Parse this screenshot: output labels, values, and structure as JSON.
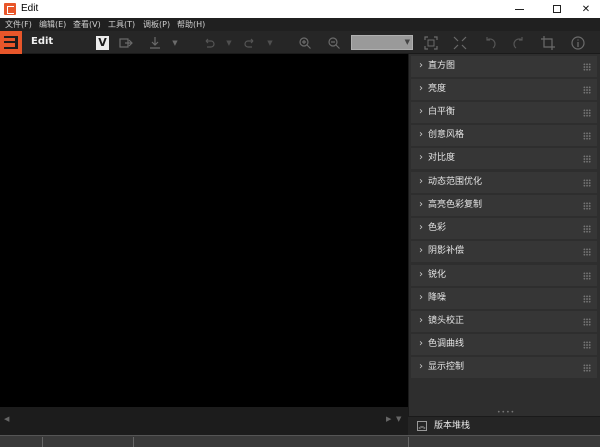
{
  "window": {
    "title": "Edit",
    "minimize_icon": "minimize-icon",
    "maximize_icon": "maximize-icon",
    "close_glyph": "✕"
  },
  "menu": [
    {
      "label": "文件(F)"
    },
    {
      "label": "编辑(E)"
    },
    {
      "label": "查看(V)"
    },
    {
      "label": "工具(T)"
    },
    {
      "label": "调板(P)"
    },
    {
      "label": "帮助(H)"
    }
  ],
  "toolbar": {
    "title": "Edit",
    "v_label": "V",
    "icons": [
      "export-icon",
      "download-icon",
      "undo-icon",
      "redo-icon",
      "zoom-in-icon",
      "zoom-out-icon",
      "fit-screen-icon",
      "actual-size-icon",
      "rotate-left-icon",
      "rotate-right-icon",
      "crop-icon",
      "info-icon"
    ]
  },
  "panel": {
    "items": [
      {
        "label": "直方图"
      },
      {
        "label": "亮度"
      },
      {
        "label": "白平衡"
      },
      {
        "label": "创意风格"
      },
      {
        "label": "对比度"
      },
      {
        "label": "动态范围优化"
      },
      {
        "label": "高亮色彩复制"
      },
      {
        "label": "色彩"
      },
      {
        "label": "阴影补偿"
      },
      {
        "label": "锐化"
      },
      {
        "label": "降噪"
      },
      {
        "label": "镜头校正"
      },
      {
        "label": "色调曲线"
      },
      {
        "label": "显示控制"
      }
    ],
    "history_label": "版本堆栈"
  },
  "colors": {
    "accent": "#e8562a",
    "canvas": "#000000",
    "panel_row": "#363636"
  }
}
